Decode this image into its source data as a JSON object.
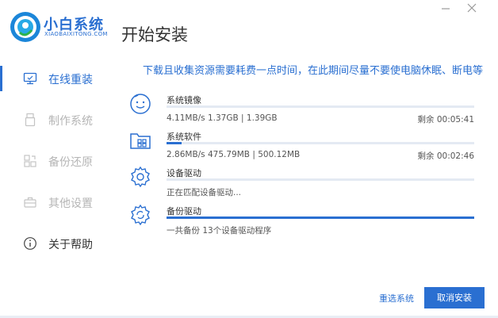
{
  "app": {
    "brand_name": "小白系统",
    "brand_sub": "XIAOBAIXITONG.COM",
    "page_title": "开始安装",
    "accent": "#2a6fd1"
  },
  "window_controls": {
    "minimize_icon": "minimize-icon",
    "close_icon": "close-icon"
  },
  "sidebar": {
    "items": [
      {
        "label": "在线重装",
        "icon": "monitor-icon",
        "state": "active"
      },
      {
        "label": "制作系统",
        "icon": "usb-drive-icon",
        "state": "disabled"
      },
      {
        "label": "备份还原",
        "icon": "backup-icon",
        "state": "disabled"
      },
      {
        "label": "其他设置",
        "icon": "toolbox-icon",
        "state": "disabled"
      },
      {
        "label": "关于帮助",
        "icon": "info-icon",
        "state": "normal"
      }
    ]
  },
  "main": {
    "notice": "下载且收集资源需要耗费一点时间，在此期间尽量不要使电脑休眠、断电等",
    "tasks": [
      {
        "name": "系统镜像",
        "icon": "disc-face-icon",
        "info": "4.11MB/s 1.37GB | 1.39GB",
        "remaining": "剩余 00:05:41",
        "progress": 0.0
      },
      {
        "name": "系统软件",
        "icon": "folder-apps-icon",
        "info": "2.86MB/s 475.79MB | 500.12MB",
        "remaining": "剩余 00:02:46",
        "progress": 0.05
      },
      {
        "name": "设备驱动",
        "icon": "gear-icon",
        "info": "正在匹配设备驱动...",
        "remaining": "",
        "progress": 0.0
      },
      {
        "name": "备份驱动",
        "icon": "gear-sync-icon",
        "info": "一共备份 13个设备驱动程序",
        "remaining": "",
        "progress": 1.0
      }
    ]
  },
  "footer": {
    "reselect_label": "重选系统",
    "cancel_label": "取消安装"
  }
}
